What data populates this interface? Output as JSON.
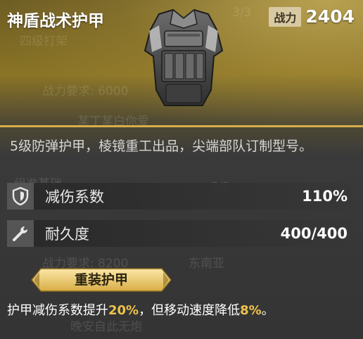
{
  "item": {
    "name": "神盾战术护甲",
    "power_label": "战力",
    "power_value": "2404",
    "description": "5级防弹护甲，棱镜重工出品，尖端部队订制型号。"
  },
  "stats": [
    {
      "label": "减伤系数",
      "value": "110%",
      "icon": "shield-icon"
    },
    {
      "label": "耐久度",
      "value": "400/400",
      "icon": "wrench-icon"
    }
  ],
  "trait": {
    "tag": "重装护甲",
    "effect_prefix": "护甲减伤系数提升",
    "effect_value1": "20%",
    "effect_mid": "，但移动速度降低",
    "effect_value2": "8%",
    "effect_suffix": "。"
  },
  "colors": {
    "accent_gold": "#d6ae4b",
    "highlight": "#f0c24a",
    "badge_bg": "#d8c9a3"
  }
}
